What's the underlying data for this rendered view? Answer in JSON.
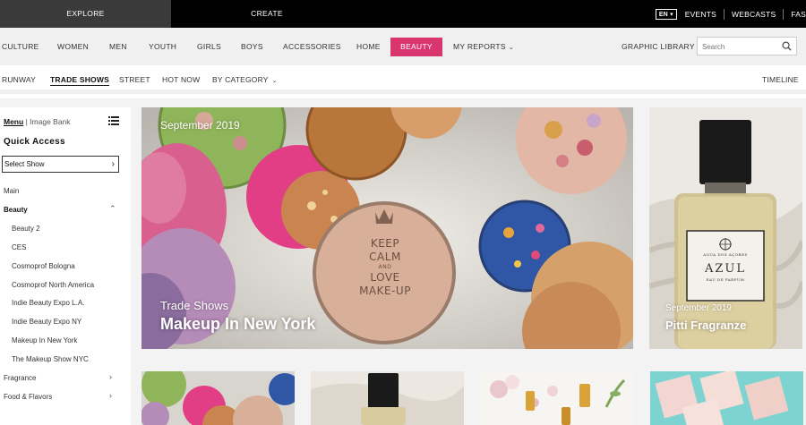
{
  "topbar": {
    "tabs": [
      {
        "label": "EXPLORE"
      },
      {
        "label": "CREATE"
      }
    ],
    "language": "EN ▾",
    "links": [
      {
        "label": "EVENTS"
      },
      {
        "label": "WEBCASTS"
      },
      {
        "label": "FAS"
      }
    ]
  },
  "main_nav": {
    "items": [
      {
        "label": "CULTURE"
      },
      {
        "label": "WOMEN"
      },
      {
        "label": "MEN"
      },
      {
        "label": "YOUTH"
      },
      {
        "label": "GIRLS"
      },
      {
        "label": "BOYS"
      },
      {
        "label": "ACCESSORIES"
      },
      {
        "label": "HOME"
      },
      {
        "label": "BEAUTY"
      },
      {
        "label": "MY REPORTS"
      }
    ],
    "graphic_library": "GRAPHIC LIBRARY",
    "search_placeholder": "Search",
    "accent_color": "#d9356f"
  },
  "sub_nav": {
    "items": [
      {
        "label": "RUNWAY"
      },
      {
        "label": "TRADE SHOWS"
      },
      {
        "label": "STREET"
      },
      {
        "label": "HOT NOW"
      },
      {
        "label": "BY CATEGORY"
      }
    ],
    "timeline": "TIMELINE"
  },
  "sidebar": {
    "menu_label": "Menu",
    "separator": "|",
    "image_bank_label": "Image Bank",
    "quick_access": "Quick Access",
    "select_show": "Select Show",
    "main": "Main",
    "beauty": "Beauty",
    "beauty_items": [
      {
        "label": "Beauty 2"
      },
      {
        "label": "CES"
      },
      {
        "label": "Cosmoprof Bologna"
      },
      {
        "label": "Cosmoprof North America"
      },
      {
        "label": "Indie Beauty Expo L.A."
      },
      {
        "label": "Indie Beauty Expo NY"
      },
      {
        "label": "Makeup In New York"
      },
      {
        "label": "The Makeup Show NYC"
      }
    ],
    "fragrance": "Fragrance",
    "food_flavors": "Food & Flavors"
  },
  "hero": {
    "date": "September 2019",
    "kicker": "Trade Shows",
    "title": "Makeup In New York",
    "compact_text": [
      "KEEP",
      "CALM",
      "AND",
      "LOVE",
      "MAKE-UP"
    ]
  },
  "side_tile": {
    "date": "September 2019",
    "title": "Pitti Fragranze",
    "bottle_brand": "AQUA DOS AÇORES",
    "bottle_name": "AZUL",
    "bottle_sub": "EAU DE PARFUM"
  }
}
